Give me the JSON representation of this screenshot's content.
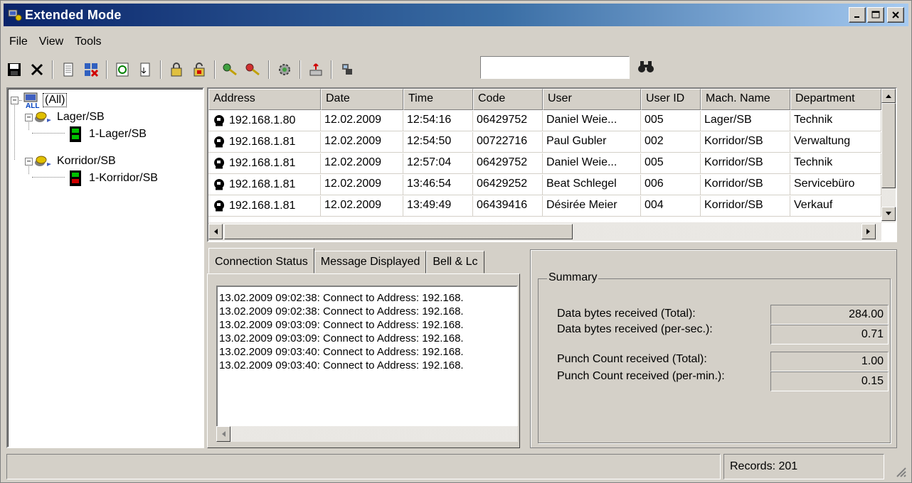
{
  "window": {
    "title": "Extended Mode"
  },
  "menu": [
    "File",
    "View",
    "Tools"
  ],
  "search": {
    "value": ""
  },
  "tree": {
    "root": "(All)",
    "groups": [
      {
        "label": "Lager/SB",
        "child": "1-Lager/SB"
      },
      {
        "label": "Korridor/SB",
        "child": "1-Korridor/SB"
      }
    ]
  },
  "grid": {
    "columns": [
      "Address",
      "Date",
      "Time",
      "Code",
      "User",
      "User ID",
      "Mach. Name",
      "Department"
    ],
    "rows": [
      [
        "192.168.1.80",
        "12.02.2009",
        "12:54:16",
        "06429752",
        "Daniel Weie...",
        "005",
        "Lager/SB",
        "Technik"
      ],
      [
        "192.168.1.81",
        "12.02.2009",
        "12:54:50",
        "00722716",
        "Paul Gubler",
        "002",
        "Korridor/SB",
        "Verwaltung"
      ],
      [
        "192.168.1.81",
        "12.02.2009",
        "12:57:04",
        "06429752",
        "Daniel Weie...",
        "005",
        "Korridor/SB",
        "Technik"
      ],
      [
        "192.168.1.81",
        "12.02.2009",
        "13:46:54",
        "06429252",
        "Beat Schlegel",
        "006",
        "Korridor/SB",
        "Servicebüro"
      ],
      [
        "192.168.1.81",
        "12.02.2009",
        "13:49:49",
        "06439416",
        "Désirée Meier",
        "004",
        "Korridor/SB",
        "Verkauf"
      ]
    ]
  },
  "tabs": [
    "Connection Status",
    "Message Displayed",
    "Bell & Lc"
  ],
  "log": [
    "13.02.2009 09:02:38: Connect to Address: 192.168.",
    "13.02.2009 09:02:38: Connect to Address: 192.168.",
    "13.02.2009 09:03:09: Connect to Address: 192.168.",
    "13.02.2009 09:03:09: Connect to Address: 192.168.",
    "13.02.2009 09:03:40: Connect to Address: 192.168.",
    "13.02.2009 09:03:40: Connect to Address: 192.168."
  ],
  "summary": {
    "title": "Summary",
    "bytes_total_label": "Data bytes received (Total):",
    "bytes_total": "284.00",
    "bytes_persec_label": "Data bytes received (per-sec.):",
    "bytes_persec": "0.71",
    "punch_total_label": "Punch Count received (Total):",
    "punch_total": "1.00",
    "punch_permin_label": "Punch Count received (per-min.):",
    "punch_permin": "0.15"
  },
  "status": {
    "records": "Records: 201"
  },
  "icons": [
    "save-icon",
    "delete-icon",
    "document-icon",
    "grid-delete-icon",
    "refresh-icon",
    "export-icon",
    "lock-icon",
    "unlock-icon",
    "key-icon",
    "key-red-icon",
    "settings-icon",
    "upload-icon",
    "network-icon",
    "binoculars-icon"
  ],
  "colors": {
    "titlebar_start": "#0a246a",
    "titlebar_end": "#a6caf0",
    "face": "#d4d0c8",
    "device_green": "#00c000",
    "device_red": "#d00000"
  }
}
